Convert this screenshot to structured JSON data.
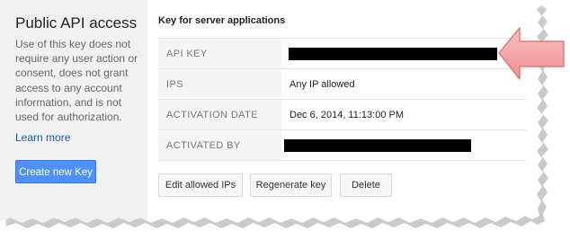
{
  "sidebar": {
    "title": "Public API access",
    "description": "Use of this key does not require any user action or consent, does not grant access to any account information, and is not used for authorization.",
    "learn_more": "Learn more",
    "create_button": "Create new Key"
  },
  "key_section": {
    "title": "Key for server applications",
    "rows": [
      {
        "label": "API KEY",
        "value": ""
      },
      {
        "label": "IPS",
        "value": "Any IP allowed"
      },
      {
        "label": "ACTIVATION DATE",
        "value": "Dec 6, 2014, 11:13:00 PM"
      },
      {
        "label": "ACTIVATED BY",
        "value": ""
      }
    ],
    "buttons": {
      "edit_ips": "Edit allowed IPs",
      "regenerate": "Regenerate key",
      "delete": "Delete"
    }
  },
  "colors": {
    "primary_button": "#4d90fe",
    "link": "#1155cc",
    "callout_arrow": "#f4a3a3",
    "redaction": "#000000"
  }
}
